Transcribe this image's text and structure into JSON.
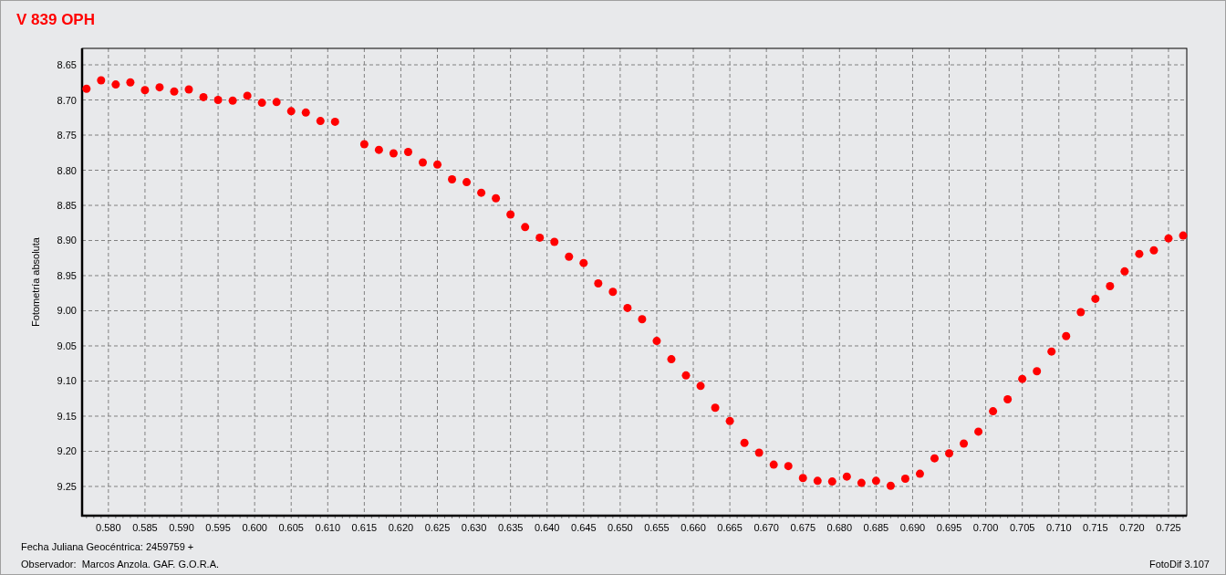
{
  "chart_data": {
    "type": "scatter",
    "grid": true,
    "title": "V 839 OPH",
    "xlabel": "Fecha Juliana Geocéntrica: 2459759 +",
    "ylabel": "Fotometría absoluta",
    "x": [
      0.577,
      0.579,
      0.581,
      0.583,
      0.585,
      0.587,
      0.589,
      0.591,
      0.593,
      0.595,
      0.597,
      0.599,
      0.601,
      0.603,
      0.605,
      0.607,
      0.609,
      0.611,
      0.615,
      0.617,
      0.619,
      0.621,
      0.623,
      0.625,
      0.627,
      0.629,
      0.631,
      0.633,
      0.635,
      0.637,
      0.639,
      0.641,
      0.643,
      0.645,
      0.647,
      0.649,
      0.651,
      0.653,
      0.655,
      0.657,
      0.659,
      0.661,
      0.663,
      0.665,
      0.667,
      0.669,
      0.671,
      0.673,
      0.675,
      0.677,
      0.679,
      0.681,
      0.683,
      0.685,
      0.687,
      0.689,
      0.691,
      0.693,
      0.695,
      0.697,
      0.699,
      0.701,
      0.703,
      0.705,
      0.707,
      0.709,
      0.711,
      0.713,
      0.715,
      0.717,
      0.719,
      0.721,
      0.723,
      0.725,
      0.727
    ],
    "series": [
      {
        "color": "#ff0000",
        "values": [
          8.684,
          8.672,
          8.678,
          8.675,
          8.686,
          8.682,
          8.688,
          8.685,
          8.696,
          8.7,
          8.701,
          8.694,
          8.704,
          8.703,
          8.716,
          8.718,
          8.73,
          8.731,
          8.763,
          8.771,
          8.776,
          8.774,
          8.789,
          8.792,
          8.813,
          8.817,
          8.832,
          8.84,
          8.863,
          8.881,
          8.896,
          8.902,
          8.923,
          8.932,
          8.961,
          8.973,
          8.996,
          9.012,
          9.043,
          9.069,
          9.092,
          9.107,
          9.138,
          9.157,
          9.188,
          9.202,
          9.219,
          9.221,
          9.238,
          9.242,
          9.243,
          9.236,
          9.245,
          9.242,
          9.249,
          9.239,
          9.232,
          9.21,
          9.203,
          9.189,
          9.172,
          9.143,
          9.126,
          9.097,
          9.086,
          9.058,
          9.036,
          9.002,
          8.983,
          8.965,
          8.944,
          8.919,
          8.914,
          8.897,
          8.893
        ]
      }
    ],
    "xlim": [
      0.5764,
      0.7275
    ],
    "ylim": [
      9.2916,
      8.6266
    ],
    "xticks": [
      {
        "value": 0.58,
        "label": "0.580"
      },
      {
        "value": 0.585,
        "label": "0.585"
      },
      {
        "value": 0.59,
        "label": "0.590"
      },
      {
        "value": 0.595,
        "label": "0.595"
      },
      {
        "value": 0.6,
        "label": "0.600"
      },
      {
        "value": 0.605,
        "label": "0.605"
      },
      {
        "value": 0.61,
        "label": "0.610"
      },
      {
        "value": 0.615,
        "label": "0.615"
      },
      {
        "value": 0.62,
        "label": "0.620"
      },
      {
        "value": 0.625,
        "label": "0.625"
      },
      {
        "value": 0.63,
        "label": "0.630"
      },
      {
        "value": 0.635,
        "label": "0.635"
      },
      {
        "value": 0.64,
        "label": "0.640"
      },
      {
        "value": 0.645,
        "label": "0.645"
      },
      {
        "value": 0.65,
        "label": "0.650"
      },
      {
        "value": 0.655,
        "label": "0.655"
      },
      {
        "value": 0.66,
        "label": "0.660"
      },
      {
        "value": 0.665,
        "label": "0.665"
      },
      {
        "value": 0.67,
        "label": "0.670"
      },
      {
        "value": 0.675,
        "label": "0.675"
      },
      {
        "value": 0.68,
        "label": "0.680"
      },
      {
        "value": 0.685,
        "label": "0.685"
      },
      {
        "value": 0.69,
        "label": "0.690"
      },
      {
        "value": 0.695,
        "label": "0.695"
      },
      {
        "value": 0.7,
        "label": "0.700"
      },
      {
        "value": 0.705,
        "label": "0.705"
      },
      {
        "value": 0.71,
        "label": "0.710"
      },
      {
        "value": 0.715,
        "label": "0.715"
      },
      {
        "value": 0.72,
        "label": "0.720"
      },
      {
        "value": 0.725,
        "label": "0.725"
      }
    ],
    "yticks": [
      {
        "value": 8.65,
        "label": "8.65"
      },
      {
        "value": 8.7,
        "label": "8.70"
      },
      {
        "value": 8.75,
        "label": "8.75"
      },
      {
        "value": 8.8,
        "label": "8.80"
      },
      {
        "value": 8.85,
        "label": "8.85"
      },
      {
        "value": 8.9,
        "label": "8.90"
      },
      {
        "value": 8.95,
        "label": "8.95"
      },
      {
        "value": 9.0,
        "label": "9.00"
      },
      {
        "value": 9.05,
        "label": "9.05"
      },
      {
        "value": 9.1,
        "label": "9.10"
      },
      {
        "value": 9.15,
        "label": "9.15"
      },
      {
        "value": 9.2,
        "label": "9.20"
      },
      {
        "value": 9.25,
        "label": "9.25"
      }
    ]
  },
  "observer": "Observador:  Marcos Anzola. GAF. G.O.R.A.",
  "software": "FotoDif 3.107"
}
